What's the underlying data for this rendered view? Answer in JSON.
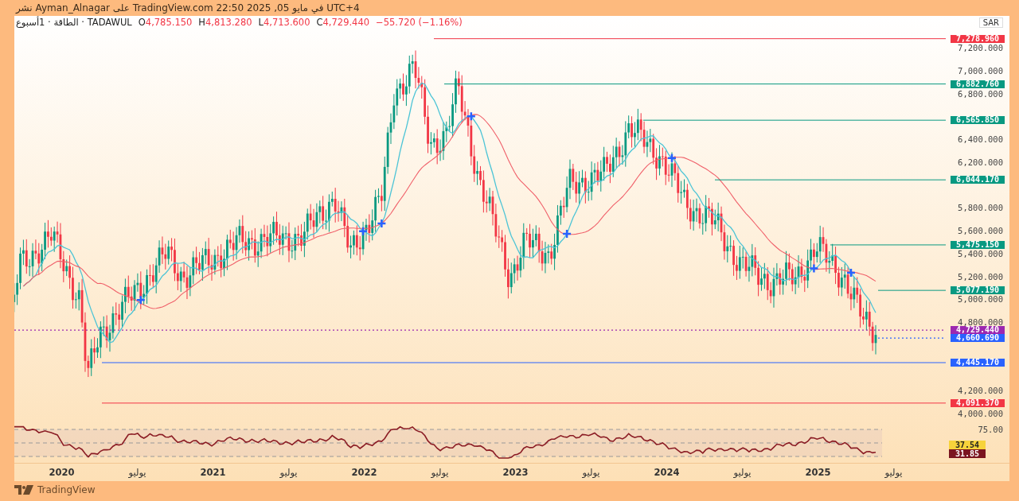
{
  "publish_bar": {
    "text": "نشر Ayman_Alnagar على TradingView.com في مايو 05, 2025 22:50 UTC+4"
  },
  "legend": {
    "symbol": "TADAWUL · الطاقة · 1أسبوع",
    "ohlc": [
      {
        "label": "O",
        "value": "4,785.150"
      },
      {
        "label": "H",
        "value": "4,813.280"
      },
      {
        "label": "L",
        "value": "4,713.600"
      },
      {
        "label": "C",
        "value": "4,729.440"
      }
    ],
    "change": "−55.720 (−1.16%)"
  },
  "currency": "SAR",
  "price_axis": {
    "ticks": [
      "7,200.000",
      "7,000.000",
      "6,800.000",
      "6,400.000",
      "6,200.000",
      "5,800.000",
      "5,600.000",
      "5,400.000",
      "5,200.000",
      "5,000.000",
      "4,800.000",
      "4,200.000",
      "4,000.000"
    ]
  },
  "levels": [
    {
      "label": "7,278.960",
      "color": "#f23645",
      "kind": "line"
    },
    {
      "label": "6,882.760",
      "color": "#089981",
      "kind": "line"
    },
    {
      "label": "6,565.850",
      "color": "#089981",
      "kind": "line"
    },
    {
      "label": "6,044.170",
      "color": "#089981",
      "kind": "line"
    },
    {
      "label": "5,475.150",
      "color": "#089981",
      "kind": "line"
    },
    {
      "label": "5,077.190",
      "color": "#089981",
      "kind": "line"
    },
    {
      "label": "4,729.440",
      "color": "#9c27b0",
      "kind": "dotted"
    },
    {
      "label": "4,660.690",
      "color": "#2962ff",
      "kind": "dotted"
    },
    {
      "label": "4,445.170",
      "color": "#2962ff",
      "kind": "line"
    },
    {
      "label": "4,091.370",
      "color": "#f23645",
      "kind": "line"
    }
  ],
  "rsi_pane": {
    "ticks": [
      "75.00"
    ],
    "tags": [
      {
        "label": "37.54",
        "color": "#f7d33b"
      },
      {
        "label": "31.85",
        "color": "#7b1520"
      }
    ]
  },
  "time_axis": [
    {
      "label": "2020",
      "kind": "year"
    },
    {
      "label": "يوليو",
      "kind": "month"
    },
    {
      "label": "2021",
      "kind": "year"
    },
    {
      "label": "يوليو",
      "kind": "month"
    },
    {
      "label": "2022",
      "kind": "year"
    },
    {
      "label": "يوليو",
      "kind": "month"
    },
    {
      "label": "2023",
      "kind": "year"
    },
    {
      "label": "يوليو",
      "kind": "month"
    },
    {
      "label": "2024",
      "kind": "year"
    },
    {
      "label": "يوليو",
      "kind": "month"
    },
    {
      "label": "2025",
      "kind": "year"
    },
    {
      "label": "يوليو",
      "kind": "month"
    }
  ],
  "footer": {
    "brand": "TradingView"
  }
}
